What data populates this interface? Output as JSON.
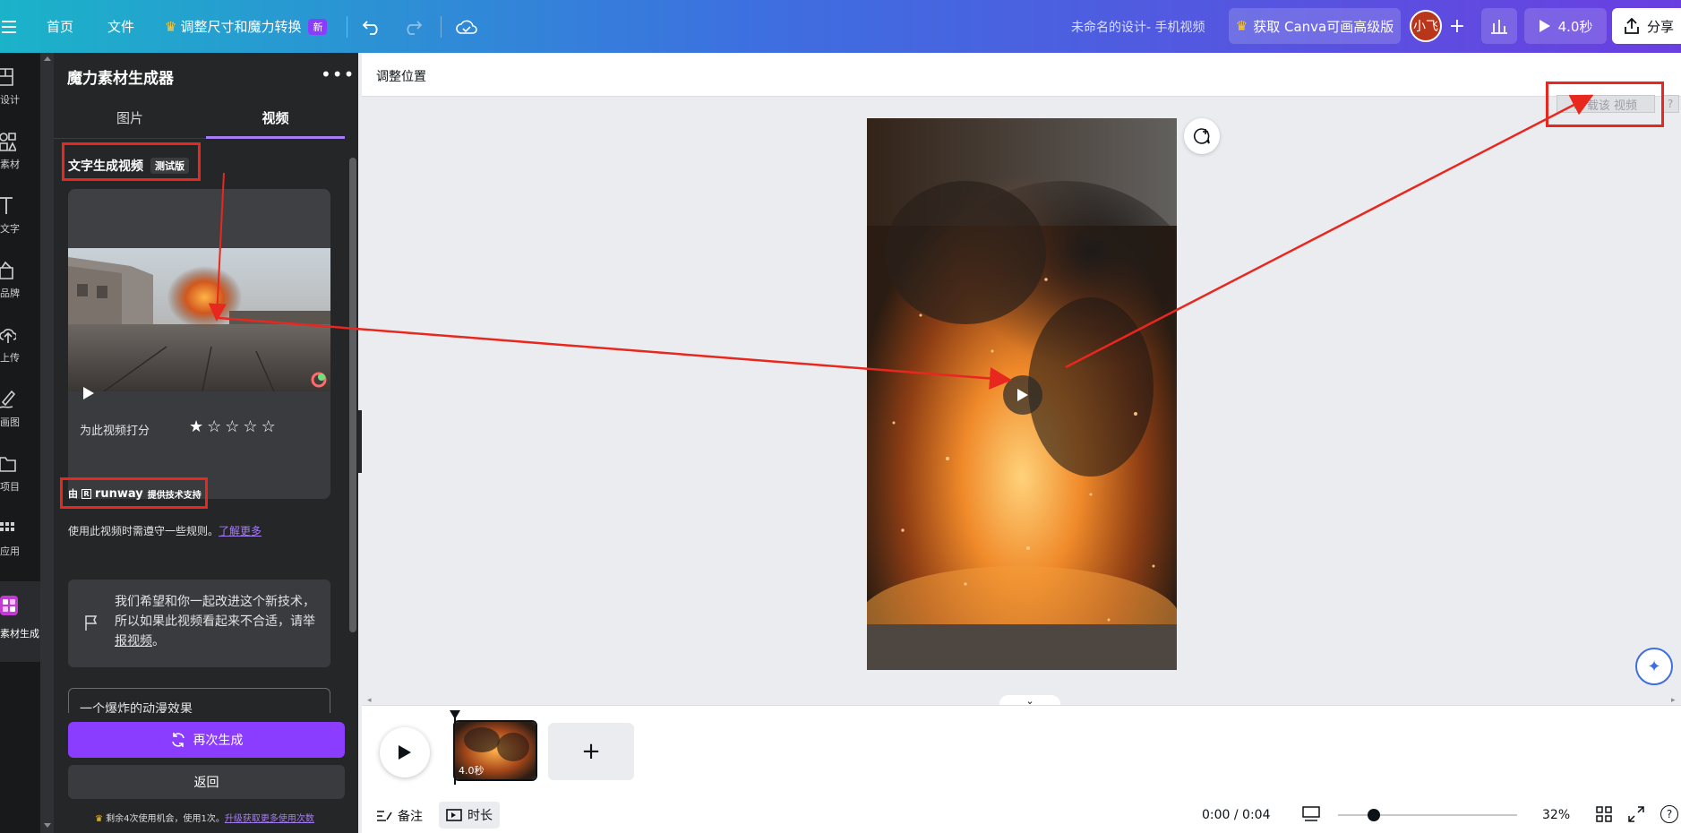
{
  "topbar": {
    "home": "首页",
    "file": "文件",
    "resize_label": "调整尺寸和魔力转换",
    "new_badge": "新",
    "doc_title": "未命名的设计- 手机视频",
    "upgrade_label": "获取 Canva可画高级版",
    "avatar_text": "小飞",
    "play_label": "4.0秒",
    "share_label": "分享"
  },
  "rail": {
    "items": [
      {
        "label": "设计",
        "icon": "layout-icon"
      },
      {
        "label": "素材",
        "icon": "shapes-icon"
      },
      {
        "label": "文字",
        "icon": "text-icon"
      },
      {
        "label": "品牌",
        "icon": "brand-icon"
      },
      {
        "label": "上传",
        "icon": "upload-icon"
      },
      {
        "label": "画图",
        "icon": "draw-icon"
      },
      {
        "label": "项目",
        "icon": "folder-icon"
      },
      {
        "label": "应用",
        "icon": "apps-icon"
      },
      {
        "label": "素材生成...",
        "icon": "magic-media-icon"
      }
    ]
  },
  "panel": {
    "title": "魔力素材生成器",
    "tabs": [
      "图片",
      "视频"
    ],
    "active_tab": "视频",
    "section_title": "文字生成视频",
    "beta_badge": "测试版",
    "rate_label": "为此视频打分",
    "rating": 1,
    "rating_max": 5,
    "powered_prefix": "由",
    "powered_brand": "runway",
    "powered_suffix": "提供技术支持",
    "rules_text": "使用此视频时需遵守一些规则。",
    "learn_more": "了解更多",
    "feedback_line1": "我们希望和你一起改进这个新技术，",
    "feedback_line2": "所以如果此视频看起来不合适，请举",
    "feedback_link": "报视频",
    "feedback_end": "。",
    "prompt_text": "一个爆炸的动漫效果",
    "regenerate": "再次生成",
    "back": "返回",
    "credits_text": "剩余4次使用机会，使用1次。",
    "credits_link": "升级获取更多使用次数"
  },
  "canvas": {
    "context_label": "调整位置",
    "load_video_label": "载该 视频",
    "help": "?"
  },
  "timeline": {
    "clip_duration": "4.0秒",
    "notes": "备注",
    "duration": "时长",
    "time": "0:00 / 0:04",
    "zoom": "32%",
    "zoom_level": 0.2
  },
  "colors": {
    "accent": "#8b3dff",
    "highlight": "#e8271f",
    "panel_bg": "#252627"
  }
}
